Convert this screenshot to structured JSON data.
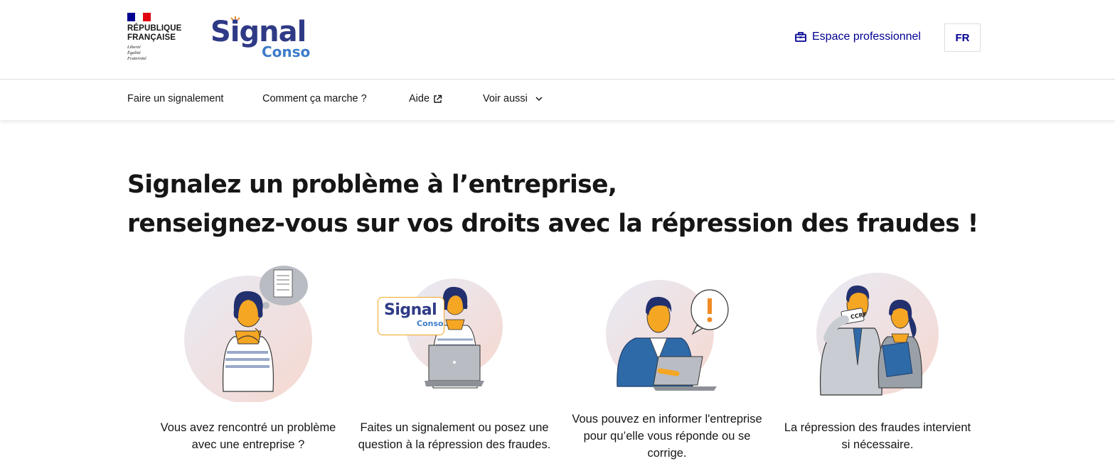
{
  "header": {
    "republic_line1": "RÉPUBLIQUE",
    "republic_line2": "FRANÇAISE",
    "motto_1": "Liberté",
    "motto_2": "Égalité",
    "motto_3": "Fraternité",
    "logo_signal": "Signal",
    "logo_conso": "Conso",
    "pro_link_label": "Espace professionnel",
    "pro_link_icon": "briefcase-icon",
    "lang_label": "FR",
    "flag_colors": [
      "#000091",
      "#ffffff",
      "#e1000f"
    ]
  },
  "nav": {
    "items": [
      {
        "label": "Faire un signalement"
      },
      {
        "label": "Comment ça marche ?"
      },
      {
        "label": "Aide",
        "icon": "external-link-icon"
      },
      {
        "label": "Voir aussi",
        "icon": "chevron-down-icon"
      }
    ]
  },
  "main": {
    "title_line1": "Signalez un problème à l’entreprise,",
    "title_line2": "renseignez-vous sur vos droits avec la répression des fraudes !",
    "steps": [
      {
        "line1": "Vous avez rencontré un problème",
        "line2": "avec une entreprise ?",
        "line3": ""
      },
      {
        "line1": "Faites un signalement ou posez une",
        "line2": "question à la répression des fraudes.",
        "line3": "",
        "bubble_signal": "Signal",
        "bubble_conso": "Conso"
      },
      {
        "line1": "Vous pouvez en informer l'entreprise",
        "line2": "pour qu’elle vous réponde ou se",
        "line3": "corrige."
      },
      {
        "line1": "La répression des fraudes intervient",
        "line2": "si nécessaire.",
        "line3": "",
        "badge": "CCRF"
      }
    ]
  },
  "colors": {
    "accent_blue": "#000091",
    "logo_navy": "#2f3a86",
    "logo_light": "#3d7cc9",
    "skin_orange": "#f5a623",
    "circle_pink": "#f6dcd6"
  }
}
